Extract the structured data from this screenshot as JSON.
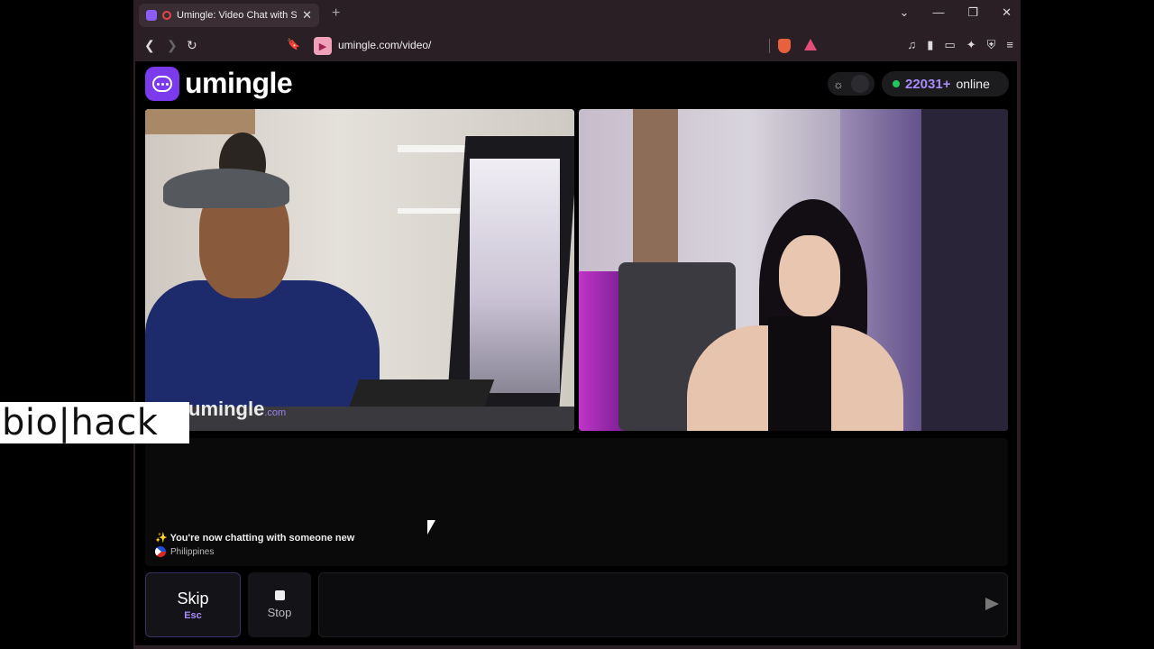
{
  "browser": {
    "tab_title": "Umingle: Video Chat with Str",
    "tab_close": "✕",
    "new_tab": "+",
    "url": "umingle.com/video/",
    "window_controls": [
      "⌄",
      "—",
      "❐",
      "✕"
    ]
  },
  "site": {
    "logo_text": "umingle",
    "online_count": "22031+",
    "online_label": "online",
    "watermark_main": "umingle",
    "watermark_suffix": ".com"
  },
  "chat": {
    "status_icon": "✨",
    "status_text": "You're now chatting with someone new",
    "country": "Philippines"
  },
  "controls": {
    "skip_label": "Skip",
    "skip_key": "Esc",
    "stop_label": "Stop"
  },
  "overlay": {
    "brand": "bio|hack"
  },
  "icons": {
    "back": "❮",
    "forward": "❯",
    "reload": "↻",
    "bookmark": "🔖",
    "sun": "☼",
    "toolbar": [
      "♫",
      "▮",
      "▭",
      "✦",
      "⛨",
      "≡"
    ]
  },
  "colors": {
    "accent": "#7c3aed",
    "online": "#22c55e",
    "count": "#a78bfa"
  }
}
